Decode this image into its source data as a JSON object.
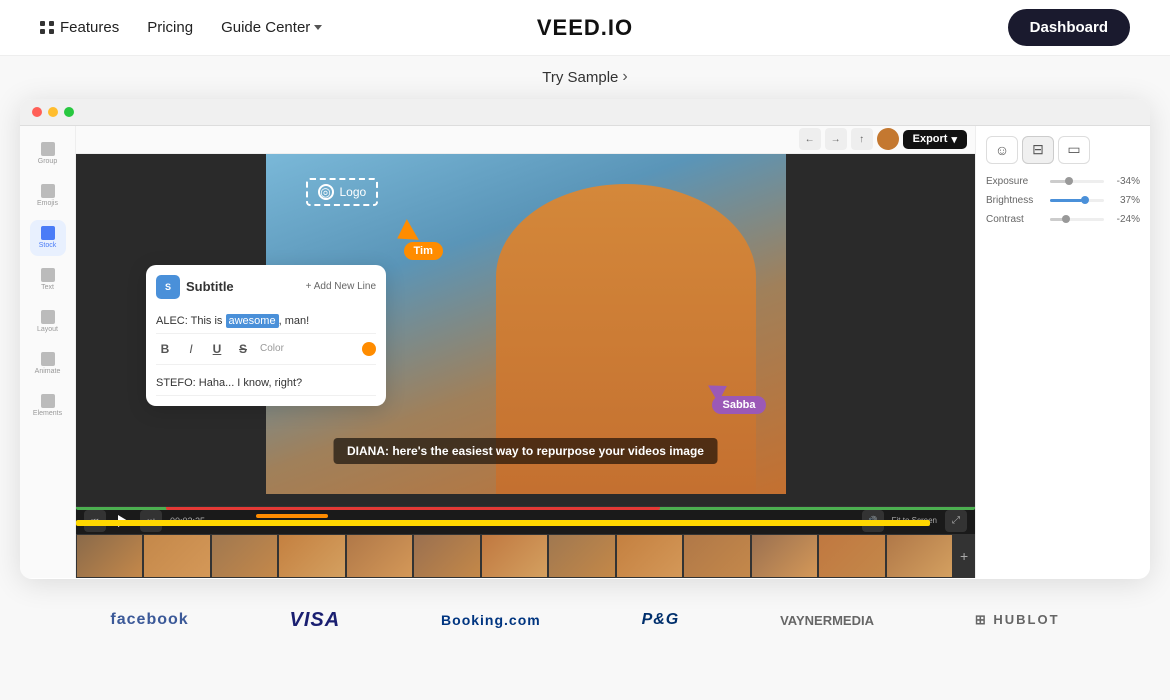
{
  "navbar": {
    "features_label": "Features",
    "pricing_label": "Pricing",
    "guide_label": "Guide Center",
    "logo": "VEED.IO",
    "dashboard_label": "Dashboard"
  },
  "try_sample": {
    "label": "Try Sample",
    "arrow": "›"
  },
  "editor": {
    "export_label": "Export",
    "subtitle_title": "Subtitle",
    "add_line_label": "+ Add New Line",
    "line1": "ALEC: This is awesome, man!",
    "line1_highlight": "awesome",
    "format_bold": "B",
    "format_italic": "I",
    "format_underline": "U",
    "format_strike": "S",
    "format_color_label": "Color",
    "line2": "STEFO: Haha... I know, right?",
    "logo_label": "Logo",
    "tim_label": "Tim",
    "sabba_label": "Sabba",
    "subtitle_text": "DIANA: here's the easiest way to repurpose your videos image",
    "exposure_label": "Exposure",
    "exposure_value": "-34%",
    "brightness_label": "Brightness",
    "brightness_value": "37%",
    "contrast_label": "Contrast",
    "contrast_value": "-24%",
    "time_display": "00:02:25"
  },
  "brands": {
    "facebook": "facebook",
    "visa": "VISA",
    "booking": "Booking.com",
    "pg": "P&G",
    "vaynermedia": "VAYNERMEDIA",
    "hublot": "⊞ HUBLOT"
  },
  "sidebar_items": [
    {
      "label": "Group"
    },
    {
      "label": "Emojis"
    },
    {
      "label": "Stock",
      "active": true
    },
    {
      "label": "Text"
    },
    {
      "label": "Layout"
    },
    {
      "label": "Animate"
    },
    {
      "label": "Elements"
    }
  ]
}
